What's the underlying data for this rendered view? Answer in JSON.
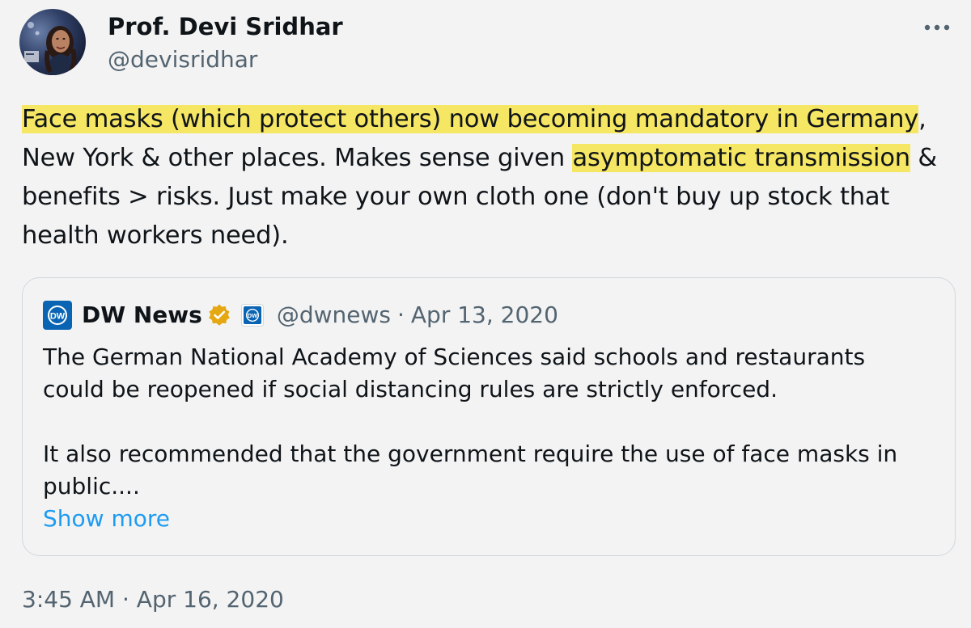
{
  "tweet": {
    "author": {
      "name": "Prof. Devi Sridhar",
      "handle": "@devisridhar"
    },
    "text_segments": [
      {
        "text": "Face masks (which protect others) now becoming mandatory in Germany",
        "highlighted": true
      },
      {
        "text": ", New York & other places. Makes sense given ",
        "highlighted": false
      },
      {
        "text": "asymptomatic transmission",
        "highlighted": true
      },
      {
        "text": " & benefits > risks. Just make your own cloth one (don't buy up stock that health workers need).",
        "highlighted": false
      }
    ],
    "timestamp": "3:45 AM · Apr 16, 2020",
    "more_icon": "more-horizontal-icon"
  },
  "quoted_tweet": {
    "name": "DW News",
    "handle": "@dwnews",
    "separator": "·",
    "date": "Apr 13, 2020",
    "logo_icon": "dw-logo-icon",
    "verified_icon": "gold-verified-badge-icon",
    "affiliate_icon": "dw-affiliate-badge-icon",
    "text": "The German National Academy of Sciences said schools and restaurants could be reopened if social distancing rules are strictly enforced.\n\nIt also recommended that the government require the use of face masks in public....",
    "show_more_label": "Show more"
  },
  "colors": {
    "background": "#f3f3f3",
    "highlight": "#f5e663",
    "link": "#1d9bf0",
    "secondary_text": "#536471",
    "dw_blue": "#0a64b4",
    "verified_gold": "#e5a812"
  }
}
